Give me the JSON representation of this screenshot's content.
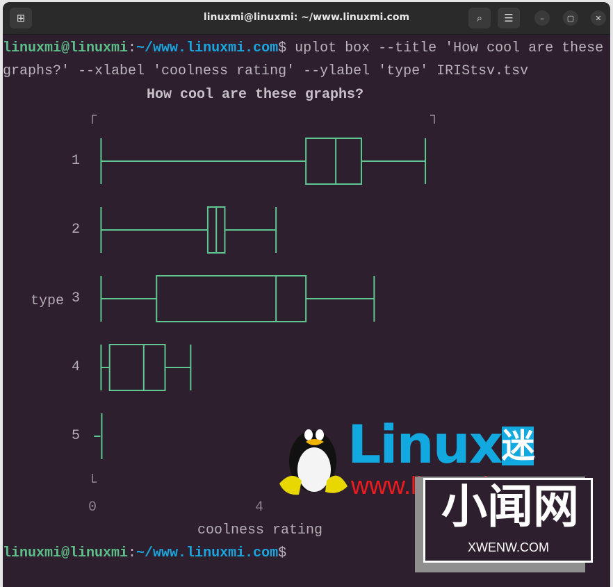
{
  "window": {
    "title": "linuxmi@linuxmi: ~/www.linuxmi.com"
  },
  "terminal": {
    "prompt_user": "linuxmi@linuxmi",
    "prompt_sep": ":",
    "prompt_path": "~/www.linuxmi.com",
    "prompt_dollar": "$",
    "command_line1": " uplot box --title 'How cool are these",
    "command_line2": "graphs?' --xlabel 'coolness rating' --ylabel 'type' IRIStsv.tsv"
  },
  "icons": {
    "new_tab": "new-tab-icon",
    "search": "search-icon",
    "menu": "hamburger-menu-icon",
    "minimize": "minimize-icon",
    "maximize": "maximize-icon",
    "close": "close-icon"
  },
  "colors": {
    "box": "#5ec890",
    "prompt_user": "#5dbf8a",
    "prompt_path": "#19a6df",
    "background": "#2e1f2e"
  },
  "chart_data": {
    "type": "box",
    "orientation": "horizontal",
    "title": "How cool are these graphs?",
    "xlabel": "coolness rating",
    "ylabel": "type",
    "xlim": [
      0,
      8
    ],
    "xticks": [
      "0",
      "4",
      "8"
    ],
    "categories": [
      "1",
      "2",
      "3",
      "4",
      "5"
    ],
    "boxes": [
      {
        "label": "1",
        "min": 0.3,
        "q1": 5.1,
        "median": 5.8,
        "q3": 6.4,
        "max": 7.9
      },
      {
        "label": "2",
        "min": 0.3,
        "q1": 2.8,
        "median": 3.0,
        "q3": 3.2,
        "max": 4.4
      },
      {
        "label": "3",
        "min": 0.3,
        "q1": 1.6,
        "median": 4.4,
        "q3": 5.1,
        "max": 6.7
      },
      {
        "label": "4",
        "min": 0.3,
        "q1": 0.5,
        "median": 1.3,
        "q3": 1.8,
        "max": 2.4
      },
      {
        "label": "5",
        "min": 0.2,
        "q1": 0.3,
        "median": 0.3,
        "q3": 0.3,
        "max": 0.3
      }
    ]
  },
  "watermarks": {
    "linux_logo": "Linux迷",
    "linux_url": "www.linuxmi.com",
    "xwenw_logo": "小闻网",
    "xwenw_url": "XWENW.COM"
  }
}
